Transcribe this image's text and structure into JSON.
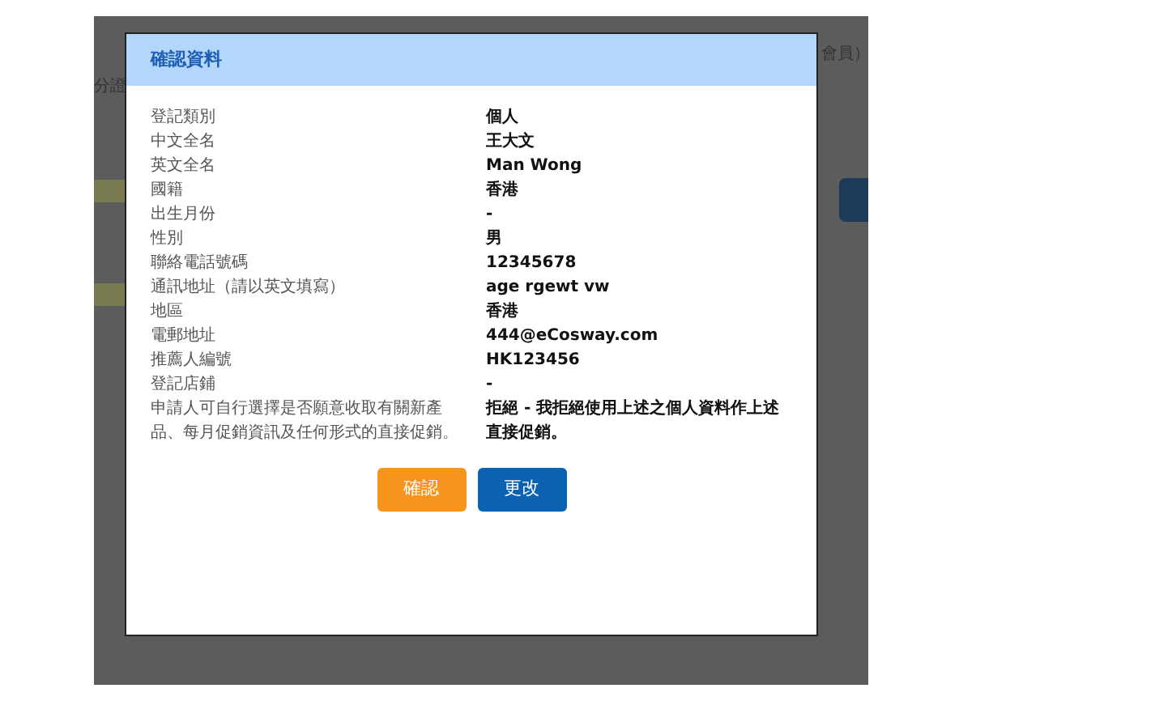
{
  "background": {
    "fragments": [
      "分證",
      "會員）"
    ]
  },
  "dialog": {
    "title": "確認資料",
    "rows": [
      {
        "label": "登記類別",
        "value": "個人"
      },
      {
        "label": "中文全名",
        "value": "王大文"
      },
      {
        "label": "英文全名",
        "value": "Man Wong"
      },
      {
        "label": "國籍",
        "value": "香港"
      },
      {
        "label": "出生月份",
        "value": "-"
      },
      {
        "label": "性別",
        "value": "男"
      },
      {
        "label": "聯絡電話號碼",
        "value": "12345678"
      },
      {
        "label": "通訊地址（請以英文填寫）",
        "value": "age rgewt vw"
      },
      {
        "label": "地區",
        "value": "香港"
      },
      {
        "label": "電郵地址",
        "value": "444@eCosway.com"
      },
      {
        "label": "推薦人編號",
        "value": "HK123456"
      },
      {
        "label": "登記店鋪",
        "value": "-"
      },
      {
        "label": "申請人可自行選擇是否願意收取有關新產品、每月促銷資訊及任何形式的直接促銷。",
        "value": "拒絕 - 我拒絕使用上述之個人資料作上述直接促銷。"
      }
    ],
    "buttons": [
      {
        "label": "確認",
        "kind": "primary"
      },
      {
        "label": "更改",
        "kind": "secondary"
      }
    ]
  }
}
